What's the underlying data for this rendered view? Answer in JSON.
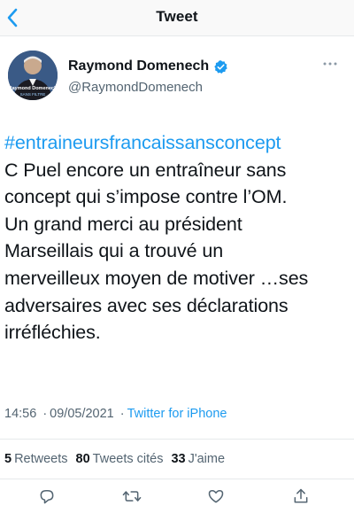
{
  "header": {
    "title": "Tweet",
    "back_icon": "chevron-left-icon"
  },
  "author": {
    "display_name": "Raymond Domenech",
    "handle": "@RaymondDomenech",
    "verified": true,
    "avatar_text": "Raymond Domenech",
    "avatar_subtext": "SANS FILTRE"
  },
  "tweet": {
    "hashtag": "#entraineursfrancaissansconcept",
    "lines": [
      "C Puel encore un entraîneur sans",
      "concept qui s’impose contre l’OM.",
      "Un grand merci au président",
      "Marseillais qui a trouvé un",
      "merveilleux moyen de motiver …ses",
      "adversaires avec ses déclarations",
      "irréfléchies."
    ],
    "time": "14:56",
    "separator": "·",
    "date": "09/05/2021",
    "source": "Twitter for iPhone"
  },
  "stats": {
    "retweets_count": "5",
    "retweets_label": "Retweets",
    "quotes_count": "80",
    "quotes_label": "Tweets cités",
    "likes_count": "33",
    "likes_label": "J'aime"
  },
  "colors": {
    "accent": "#1d9bf0",
    "secondary_text": "#536471",
    "primary_text": "#0f1419",
    "divider": "#e6e9eb"
  }
}
